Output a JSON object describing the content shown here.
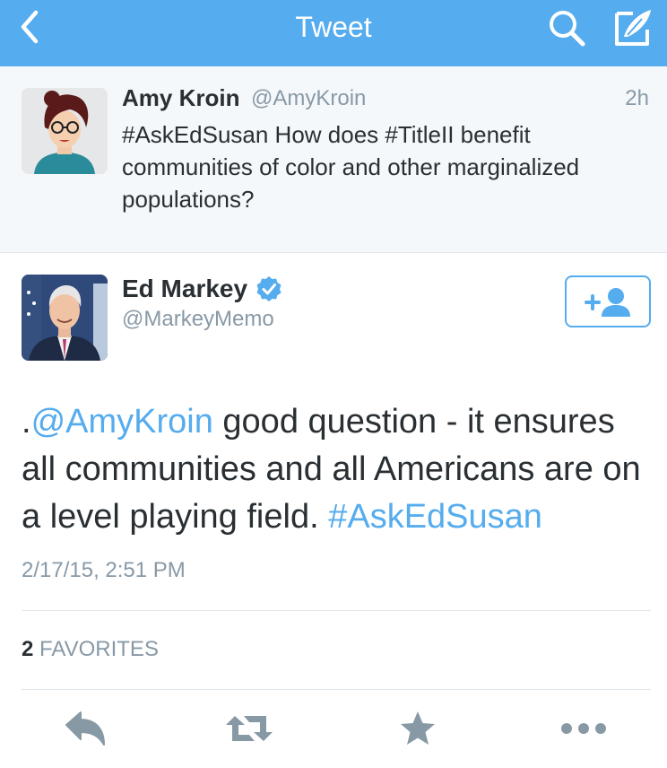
{
  "navbar": {
    "title": "Tweet",
    "color": "#55acee"
  },
  "parent_tweet": {
    "author_name": "Amy Kroin",
    "author_handle": "@AmyKroin",
    "time": "2h",
    "text": "#AskEdSusan How does #TitleII benefit communities of color and other marginalized populations?"
  },
  "main_tweet": {
    "author_name": "Ed Markey",
    "author_handle": "@MarkeyMemo",
    "verified": true,
    "text_prefix": ".",
    "mention": "@AmyKroin",
    "text_body": " good question - it ensures all communities and all Americans are on a level playing field. ",
    "hashtag": "#AskEdSusan",
    "date": "2/17/15, 2:51 PM",
    "favorites_count": "2",
    "favorites_label": "FAVORITES"
  },
  "icons": {
    "back": "chevron-left-icon",
    "search": "search-icon",
    "compose": "compose-icon",
    "follow": "follow-user-icon",
    "reply": "reply-icon",
    "retweet": "retweet-icon",
    "favorite": "star-icon",
    "more": "more-icon"
  },
  "colors": {
    "accent": "#55acee",
    "secondary_text": "#8899a6",
    "action_icons": "#8899a6"
  }
}
